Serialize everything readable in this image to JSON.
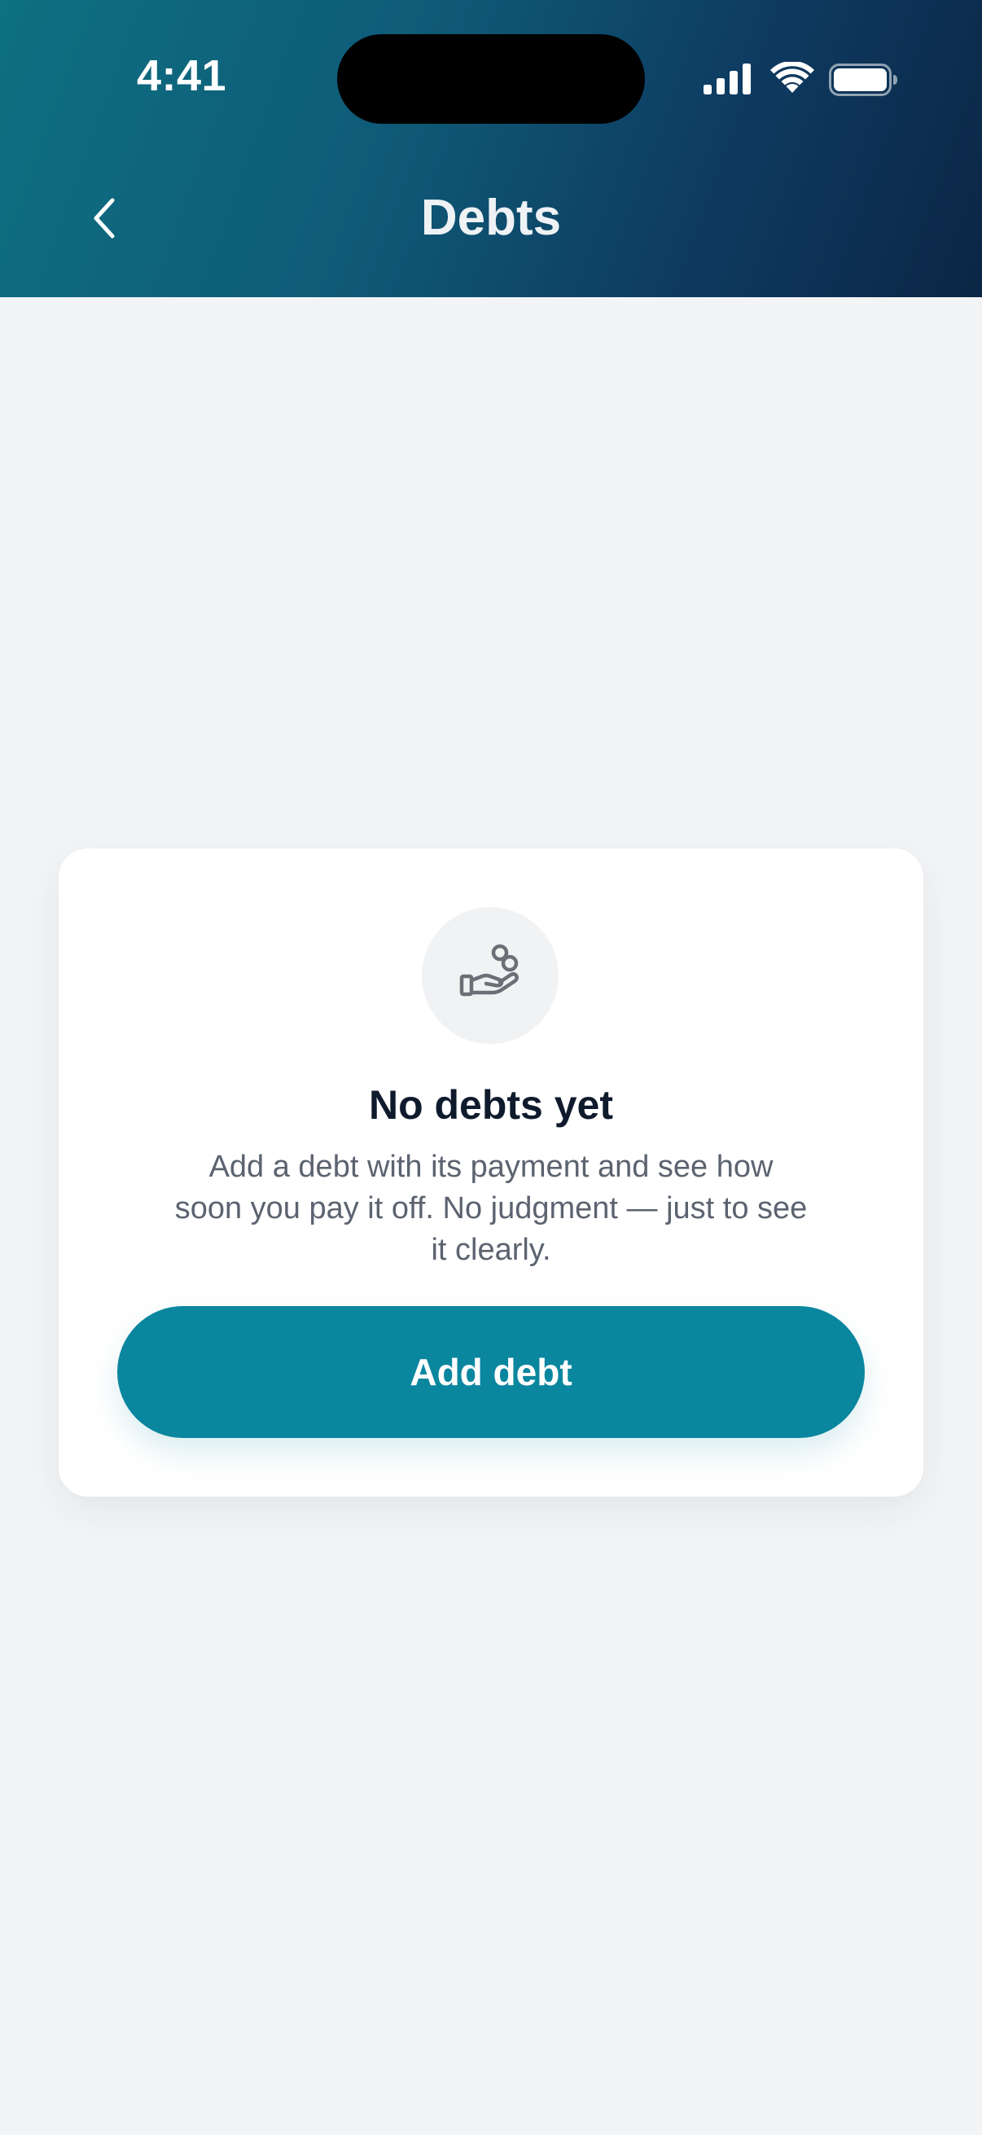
{
  "status_bar": {
    "time": "4:41",
    "icons": [
      "cellular-signal-icon",
      "wifi-icon",
      "battery-icon"
    ]
  },
  "header": {
    "title": "Debts",
    "back_icon": "chevron-left-icon"
  },
  "empty_state": {
    "icon": "hand-coins-icon",
    "title": "No debts yet",
    "description": "Add a debt with its payment and see how soon you pay it off. No judgment — just to see it clearly.",
    "button_label": "Add debt"
  },
  "colors": {
    "header_gradient_start": "#0e7081",
    "header_gradient_end": "#0b2645",
    "accent": "#0a869f",
    "background": "#f3f4f6",
    "title_text": "#0f1b2d",
    "body_text": "#5c6370"
  }
}
